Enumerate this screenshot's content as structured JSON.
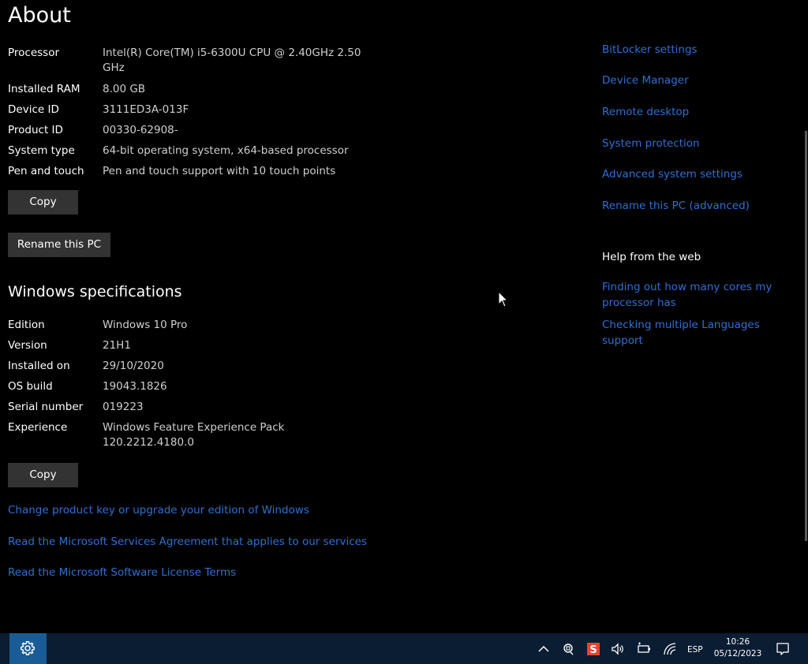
{
  "page": {
    "title": "About"
  },
  "device_specs": {
    "rows": [
      {
        "label": "Processor",
        "value": "Intel(R) Core(TM) i5-6300U CPU @ 2.40GHz   2.50 GHz"
      },
      {
        "label": "Installed RAM",
        "value": "8.00 GB"
      },
      {
        "label": "Device ID",
        "value": "3111ED3A-013F"
      },
      {
        "label": "Product ID",
        "value": "00330-62908-"
      },
      {
        "label": "System type",
        "value": "64-bit operating system, x64-based processor"
      },
      {
        "label": "Pen and touch",
        "value": "Pen and touch support with 10 touch points"
      }
    ],
    "copy_label": "Copy",
    "rename_label": "Rename this PC"
  },
  "windows_specs": {
    "heading": "Windows specifications",
    "rows": [
      {
        "label": "Edition",
        "value": "Windows 10 Pro"
      },
      {
        "label": "Version",
        "value": "21H1"
      },
      {
        "label": "Installed on",
        "value": "29/10/2020"
      },
      {
        "label": "OS build",
        "value": "19043.1826"
      },
      {
        "label": "Serial number",
        "value": "019223"
      },
      {
        "label": "Experience",
        "value": "Windows Feature Experience Pack 120.2212.4180.0"
      }
    ],
    "copy_label": "Copy"
  },
  "bottom_links": [
    "Change product key or upgrade your edition of Windows",
    "Read the Microsoft Services Agreement that applies to our services",
    "Read the Microsoft Software License Terms"
  ],
  "related_links": [
    "BitLocker settings",
    "Device Manager",
    "Remote desktop",
    "System protection",
    "Advanced system settings",
    "Rename this PC (advanced)"
  ],
  "help": {
    "heading": "Help from the web",
    "links": [
      "Finding out how many cores my processor has",
      "Checking multiple Languages support"
    ]
  },
  "taskbar": {
    "language": "ESP",
    "time": "10:26",
    "date": "05/12/2023",
    "icons": [
      "gear-icon",
      "chevron-up-icon",
      "meet-now-icon",
      "app-s-icon",
      "volume-icon",
      "battery-icon",
      "wifi-icon",
      "notification-icon"
    ]
  },
  "colors": {
    "background": "#000000",
    "link": "#2f6fd3",
    "button": "#333333",
    "taskbar": "#0b1d33",
    "start_tile": "#1a5c96",
    "app_s_icon": "#e8452c"
  }
}
